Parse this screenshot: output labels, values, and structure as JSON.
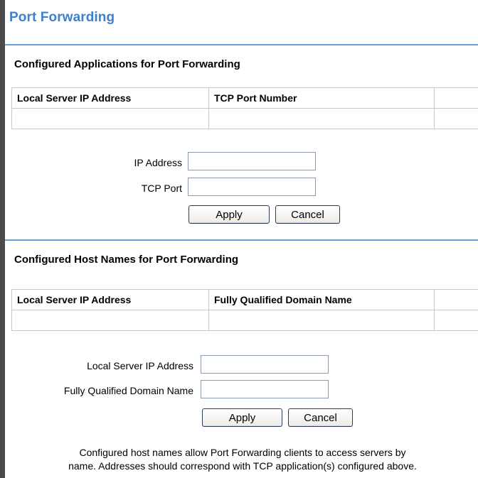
{
  "page": {
    "title": "Port Forwarding"
  },
  "applications": {
    "section_title": "Configured Applications for Port Forwarding",
    "table": {
      "headers": [
        "Local Server IP Address",
        "TCP Port Number",
        ""
      ],
      "rows": [
        [
          "",
          "",
          ""
        ]
      ]
    },
    "form": {
      "ip_label": "IP Address",
      "ip_value": "",
      "port_label": "TCP Port",
      "port_value": "",
      "apply_label": "Apply",
      "cancel_label": "Cancel"
    }
  },
  "hosts": {
    "section_title": "Configured Host Names for Port Forwarding",
    "table": {
      "headers": [
        "Local Server IP Address",
        "Fully Qualified Domain Name",
        ""
      ],
      "rows": [
        [
          "",
          "",
          ""
        ]
      ]
    },
    "form": {
      "ip_label": "Local Server IP Address",
      "ip_value": "",
      "fqdn_label": "Fully Qualified Domain Name",
      "fqdn_value": "",
      "apply_label": "Apply",
      "cancel_label": "Cancel"
    },
    "note_line1": "Configured host names allow Port Forwarding clients to access servers by",
    "note_line2": "name. Addresses should correspond with TCP application(s) configured above."
  }
}
